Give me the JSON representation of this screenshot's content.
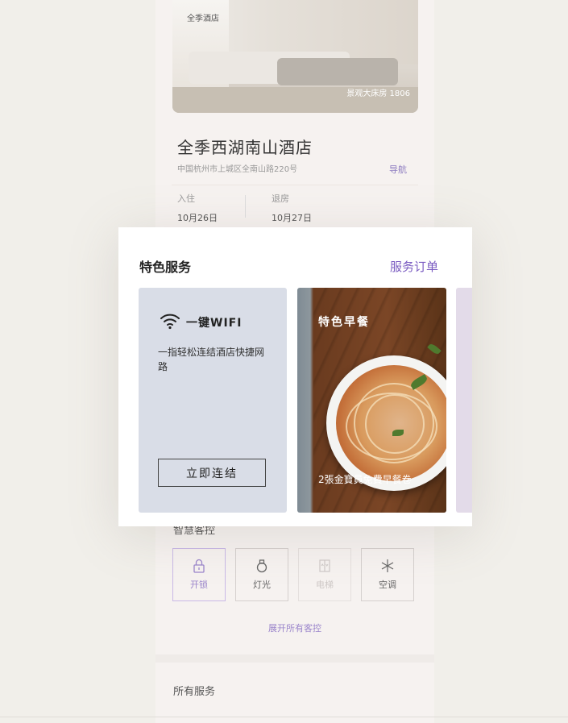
{
  "hotel": {
    "logo_text": "全季酒店",
    "room_caption": "景观大床房 1806",
    "name": "全季西湖南山酒店",
    "address": "中国杭州市上城区全南山路220号",
    "nav_label": "导航",
    "checkin_label": "入住",
    "checkin_date": "10月26日",
    "checkout_label": "退房",
    "checkout_date": "10月27日"
  },
  "featured": {
    "title": "特色服务",
    "orders_link": "服务订单",
    "wifi": {
      "title": "一键WIFI",
      "description": "一指轻松连结酒店快捷网路",
      "button": "立即连结"
    },
    "breakfast": {
      "title": "特色早餐",
      "caption": "2張金寶員免費早餐卷"
    }
  },
  "room_control": {
    "title": "智慧客控",
    "items": [
      {
        "label": "开锁",
        "icon": "lock-icon"
      },
      {
        "label": "灯光",
        "icon": "light-bulb-icon"
      },
      {
        "label": "电梯",
        "icon": "elevator-icon"
      },
      {
        "label": "空调",
        "icon": "snowflake-icon"
      }
    ],
    "expand_label": "展开所有客控"
  },
  "all_services": {
    "title": "所有服务"
  },
  "colors": {
    "accent": "#7a5bc1",
    "wifi_tile": "#d9dde7",
    "page_bg": "#f1efea"
  }
}
